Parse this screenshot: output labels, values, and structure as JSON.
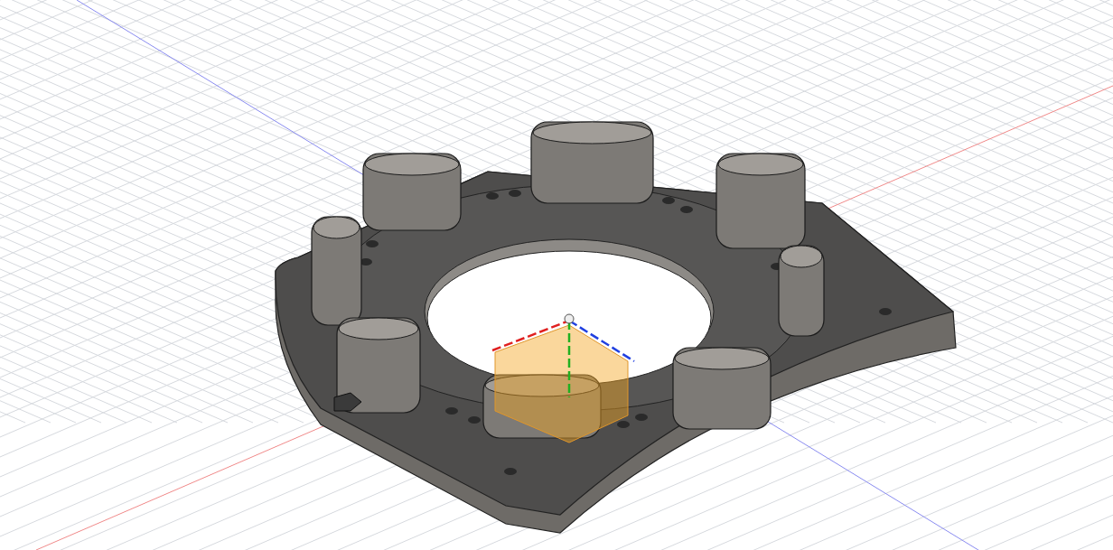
{
  "viewport": {
    "grid_visible": true,
    "axes_visible": true,
    "origin_visible": true
  }
}
